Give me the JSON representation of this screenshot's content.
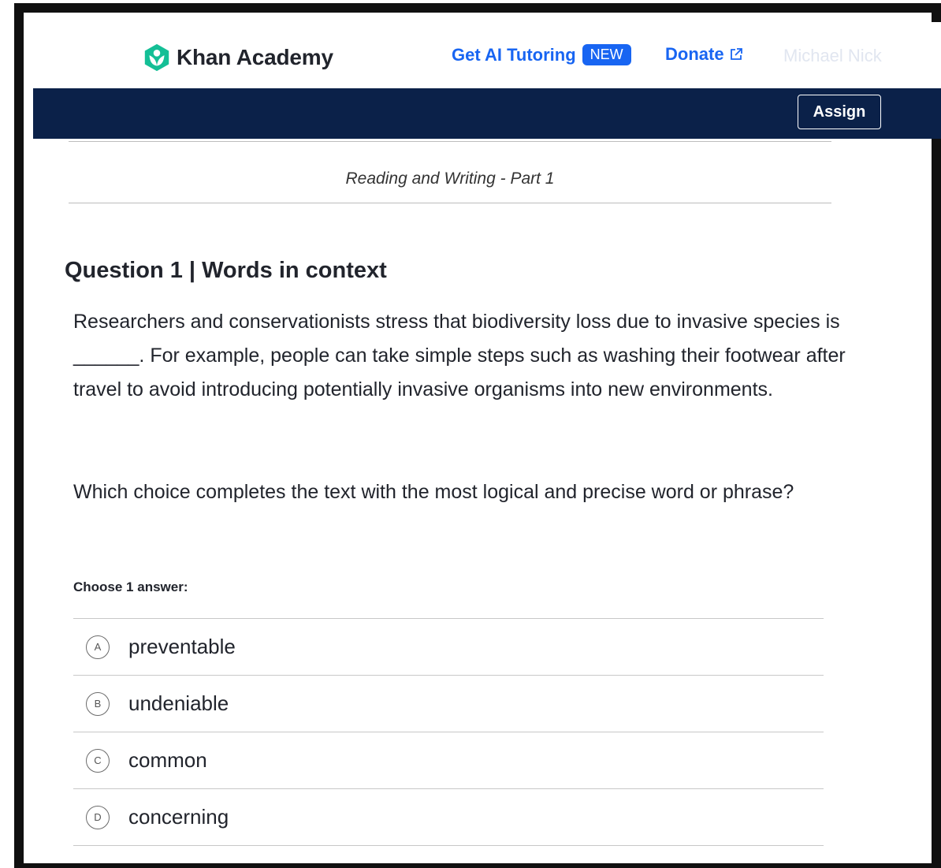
{
  "header": {
    "brand": "Khan Academy",
    "tutoring_link": "Get AI Tutoring",
    "tutoring_badge": "NEW",
    "donate_link": "Donate",
    "user_name": "Michael Nick",
    "accent_color": "#1865f2",
    "brand_color": "#14bf96",
    "navbar_color": "#0b2149"
  },
  "toolbar": {
    "assign_label": "Assign"
  },
  "section": {
    "title": "Reading and Writing - Part 1"
  },
  "question": {
    "heading": "Question 1 | Words in context",
    "passage": "Researchers and conservationists stress that biodiversity loss due to invasive species is ______. For example, people can take simple steps such as washing their footwear after travel to avoid introducing potentially invasive organisms into new environments.",
    "prompt": "Which choice completes the text with the most logical and precise word or phrase?",
    "choose_label": "Choose 1 answer:",
    "choices": [
      {
        "letter": "A",
        "text": "preventable"
      },
      {
        "letter": "B",
        "text": "undeniable"
      },
      {
        "letter": "C",
        "text": "common"
      },
      {
        "letter": "D",
        "text": "concerning"
      }
    ]
  },
  "icons": {
    "logo": "khan-hexagon-icon",
    "external": "external-link-icon"
  }
}
